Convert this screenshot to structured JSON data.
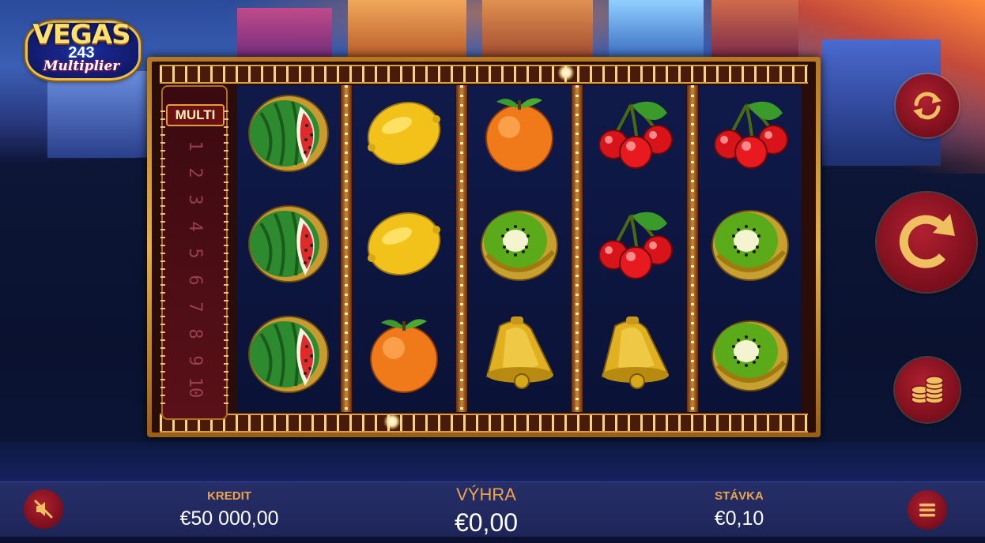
{
  "logo": {
    "line1": "VEGAS",
    "line2": "243",
    "line3": "Multiplier"
  },
  "multiplier": {
    "label": "MULTI",
    "levels": [
      "1",
      "2",
      "3",
      "4",
      "5",
      "6",
      "7",
      "8",
      "9",
      "10"
    ]
  },
  "reels": [
    [
      "watermelon",
      "watermelon",
      "watermelon"
    ],
    [
      "lemon",
      "lemon",
      "orange"
    ],
    [
      "orange",
      "kiwi",
      "bell"
    ],
    [
      "cherries",
      "cherries",
      "bell"
    ],
    [
      "cherries",
      "kiwi",
      "kiwi"
    ]
  ],
  "controls": {
    "autoplay_icon": "autoplay-icon",
    "spin_icon": "spin-icon",
    "bet_icon": "coins-icon",
    "mute_icon": "sound-muted-icon",
    "menu_icon": "menu-icon"
  },
  "bottom_bar": {
    "credit_label": "KREDIT",
    "credit_value": "€50 000,00",
    "win_label": "VÝHRA",
    "win_value": "€0,00",
    "bet_label": "STÁVKA",
    "bet_value": "€0,10"
  },
  "colors": {
    "accent_label": "#f0a44a",
    "button_red": "#7a0e1c",
    "button_icon_gold": "#f0c060",
    "bar_bg": "#1d2558"
  }
}
